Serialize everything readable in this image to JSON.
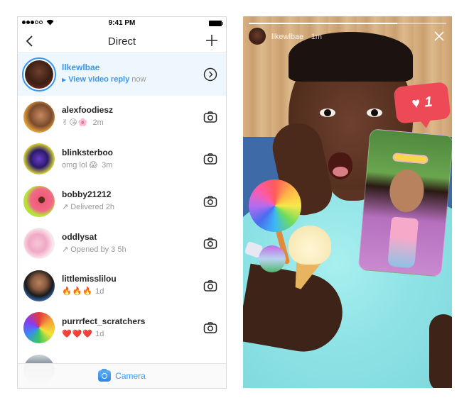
{
  "status_bar": {
    "signal_bars_filled": 3,
    "signal_bars_total": 5,
    "time": "9:41 PM",
    "battery": "full"
  },
  "header": {
    "back_icon": "chevron-left-icon",
    "title": "Direct",
    "new_icon": "plus-icon"
  },
  "threads": [
    {
      "username": "llkewlbae",
      "highlighted": true,
      "status_prefix_icon": "play-triangle-icon",
      "status_action": "View video reply",
      "time": "now",
      "action_icon": "chevron-right-circle-icon"
    },
    {
      "username": "alexfoodiesz",
      "status_text": "✌😘🌸",
      "time": "2m",
      "action_icon": "camera-icon"
    },
    {
      "username": "blinksterboo",
      "status_text": "omg lol 😱",
      "time": "3m",
      "action_icon": "camera-icon"
    },
    {
      "username": "bobby21212",
      "status_prefix_icon": "sent-arrow-icon",
      "status_text": "Delivered",
      "time": "2h",
      "action_icon": "camera-icon"
    },
    {
      "username": "oddlysat",
      "status_prefix_icon": "sent-arrow-icon",
      "status_text": "Opened by 3",
      "time": "5h",
      "action_icon": "camera-icon"
    },
    {
      "username": "littlemisslilou",
      "status_text": "🔥🔥🔥",
      "time": "1d",
      "action_icon": "camera-icon"
    },
    {
      "username": "purrrfect_scratchers",
      "status_text": "❤️❤️❤️",
      "time": "1d",
      "action_icon": "camera-icon"
    }
  ],
  "bottom_bar": {
    "icon": "camera-icon",
    "label": "Camera",
    "accent_color": "#3897f0"
  },
  "story": {
    "progress": 0.75,
    "username": "llkewlbae",
    "time": "1m",
    "close_icon": "close-icon",
    "like_sticker": {
      "icon": "heart-icon",
      "count": "1",
      "color": "#ed4956"
    },
    "stickers": [
      "lollipop",
      "wrapped-candy",
      "ice-cream"
    ]
  },
  "colors": {
    "accent": "#3897f0",
    "highlight_bg": "#eef6fe",
    "text_primary": "#262626",
    "text_secondary": "#999999"
  }
}
